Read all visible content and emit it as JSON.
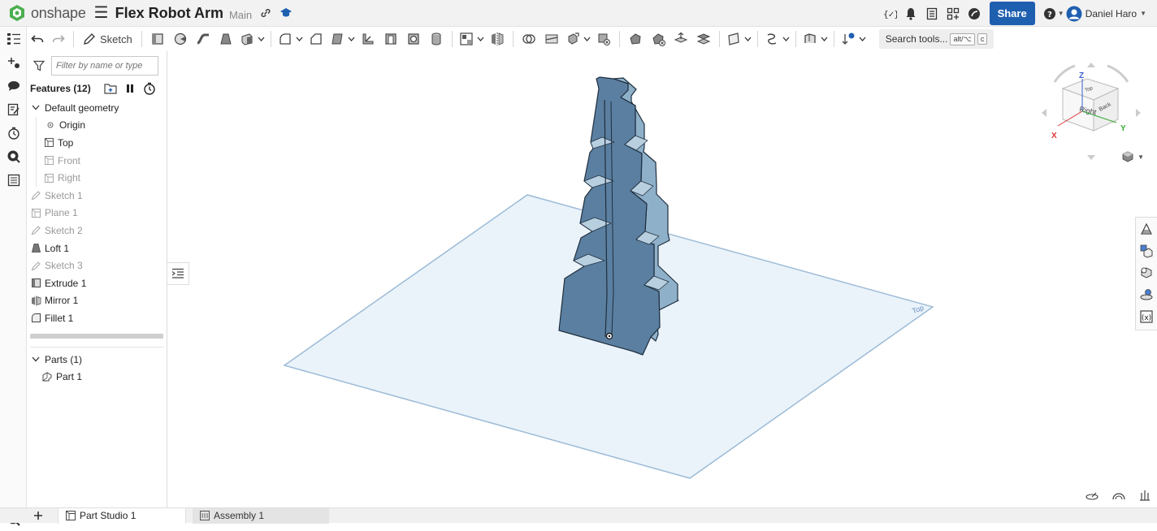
{
  "app": {
    "logo_text": "onshape",
    "doc_title": "Flex Robot Arm",
    "branch": "Main"
  },
  "topbar": {
    "share_label": "Share",
    "user_name": "Daniel Haro",
    "icons": [
      "variable-studio-icon",
      "bell-icon",
      "notes-icon",
      "app-store-icon",
      "learning-icon",
      "help-icon"
    ]
  },
  "toolbar": {
    "sketch_label": "Sketch",
    "search_label": "Search tools...",
    "search_kbd1": "alt/⌥",
    "search_kbd2": "c"
  },
  "panel": {
    "filter_placeholder": "Filter by name or type",
    "features_header": "Features (12)",
    "default_geometry_label": "Default geometry",
    "items": [
      {
        "label": "Origin",
        "icon": "origin-icon",
        "dim": false
      },
      {
        "label": "Top",
        "icon": "plane-icon",
        "dim": false
      },
      {
        "label": "Front",
        "icon": "plane-icon",
        "dim": true
      },
      {
        "label": "Right",
        "icon": "plane-icon",
        "dim": true
      },
      {
        "label": "Sketch 1",
        "icon": "sketch-icon",
        "dim": true
      },
      {
        "label": "Plane 1",
        "icon": "plane-icon",
        "dim": true
      },
      {
        "label": "Sketch 2",
        "icon": "sketch-icon",
        "dim": true
      },
      {
        "label": "Loft 1",
        "icon": "loft-icon",
        "dim": false
      },
      {
        "label": "Sketch 3",
        "icon": "sketch-icon",
        "dim": true
      },
      {
        "label": "Extrude 1",
        "icon": "extrude-icon",
        "dim": false
      },
      {
        "label": "Mirror 1",
        "icon": "mirror-icon",
        "dim": false
      },
      {
        "label": "Fillet 1",
        "icon": "fillet-icon",
        "dim": false
      }
    ],
    "parts_header": "Parts (1)",
    "parts": [
      {
        "label": "Part 1",
        "icon": "part-icon"
      }
    ]
  },
  "viewcube": {
    "axis_z": "Z",
    "axis_x": "X",
    "axis_y": "Y",
    "face_right": "Right",
    "face_back": "Back",
    "face_top": "Top",
    "plane_label": "Top"
  },
  "tabs": [
    {
      "label": "Part Studio 1",
      "active": true
    },
    {
      "label": "Assembly 1",
      "active": false
    }
  ],
  "colors": {
    "accent": "#1f5fb0",
    "logo_green": "#4caf50",
    "part_fill": "#5b7fa0",
    "plane_fill": "#eaf3fa",
    "plane_edge": "#9dbbd6"
  }
}
